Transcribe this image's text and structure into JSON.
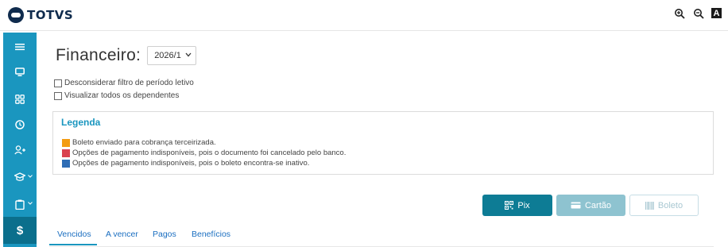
{
  "header": {
    "logo_text": "TOTVS",
    "tools": [
      {
        "icon": "zoom-in-icon"
      },
      {
        "icon": "zoom-out-icon"
      },
      {
        "icon": "contrast-icon",
        "label": "A"
      }
    ]
  },
  "sidebar": {
    "items": [
      {
        "icon": "menu-icon"
      },
      {
        "icon": "monitor-icon"
      },
      {
        "icon": "dashboard-icon"
      },
      {
        "icon": "clock-icon"
      },
      {
        "icon": "add-user-icon"
      },
      {
        "icon": "graduation-cap-icon",
        "has_chevron": true
      },
      {
        "icon": "clipboard-icon",
        "has_chevron": true
      },
      {
        "icon": "dollar-icon",
        "label": "$",
        "active": true
      }
    ]
  },
  "main": {
    "title": "Financeiro:",
    "period": {
      "selected": "2026/1"
    },
    "checkboxes": [
      {
        "label": "Desconsiderar filtro de período letivo",
        "checked": false
      },
      {
        "label": "Visualizar todos os dependentes",
        "checked": false
      }
    ],
    "legend": {
      "title": "Legenda",
      "items": [
        {
          "color": "#f39c12",
          "text": "Boleto enviado para cobrança terceirizada."
        },
        {
          "color": "#d9414f",
          "text": "Opções de pagamento indisponíveis, pois o documento foi cancelado pelo banco."
        },
        {
          "color": "#2f6db5",
          "text": "Opções de pagamento indisponíveis, pois o boleto encontra-se inativo."
        }
      ]
    },
    "buttons": {
      "pix": "Pix",
      "cartao": "Cartão",
      "boleto": "Boleto"
    },
    "tabs": [
      {
        "label": "Vencidos",
        "active": true
      },
      {
        "label": "A vencer"
      },
      {
        "label": "Pagos"
      },
      {
        "label": "Benefícios"
      }
    ]
  },
  "colors": {
    "sidebar": "#1a96bf",
    "sidebar_active": "#0b6f8c",
    "primary_button": "#0d7c95",
    "accent": "#1a96bf"
  }
}
